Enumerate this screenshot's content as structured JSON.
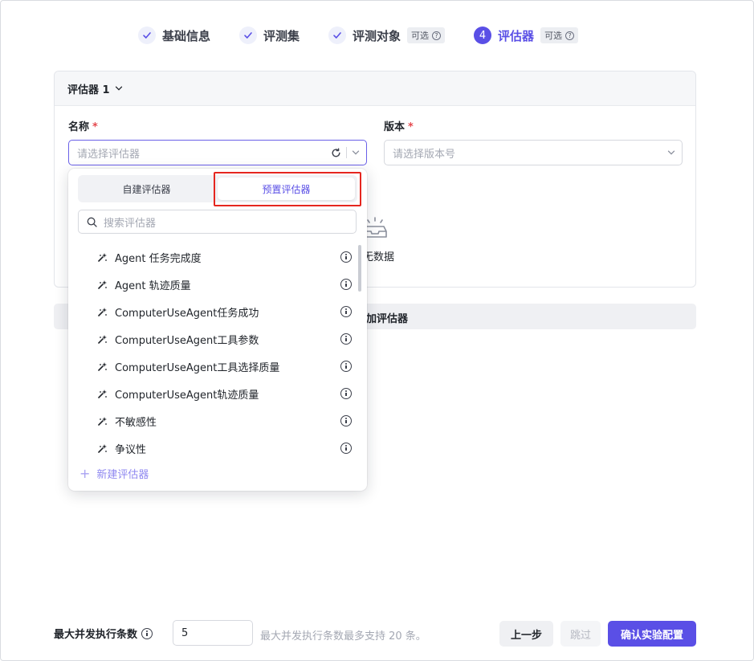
{
  "steps": [
    {
      "label": "基础信息",
      "state": "done"
    },
    {
      "label": "评测集",
      "state": "done"
    },
    {
      "label": "评测对象",
      "state": "done",
      "badge": "可选"
    },
    {
      "label": "评估器",
      "state": "active",
      "number": "4",
      "badge": "可选"
    }
  ],
  "card": {
    "title": "评估器 1",
    "name_label": "名称",
    "version_label": "版本",
    "required_mark": "*",
    "name_placeholder": "请选择评估器",
    "version_placeholder": "请选择版本号",
    "nodata_text": "无数据"
  },
  "add_evaluator_text": "加评估器",
  "dropdown": {
    "tabs": [
      "自建评估器",
      "预置评估器"
    ],
    "active_tab": "预置评估器",
    "search_placeholder": "搜索评估器",
    "items": [
      "Agent 任务完成度",
      "Agent 轨迹质量",
      "ComputerUseAgent任务成功",
      "ComputerUseAgent工具参数",
      "ComputerUseAgent工具选择质量",
      "ComputerUseAgent轨迹质量",
      "不敏感性",
      "争议性"
    ],
    "new_label": "新建评估器"
  },
  "footer": {
    "concurrency_label": "最大并发执行条数",
    "concurrency_value": "5",
    "hint": "最大并发执行条数最多支持 20 条。",
    "prev": "上一步",
    "skip": "跳过",
    "confirm": "确认实验配置"
  },
  "colors": {
    "accent": "#5a4fe6",
    "highlight": "#e5261f"
  }
}
